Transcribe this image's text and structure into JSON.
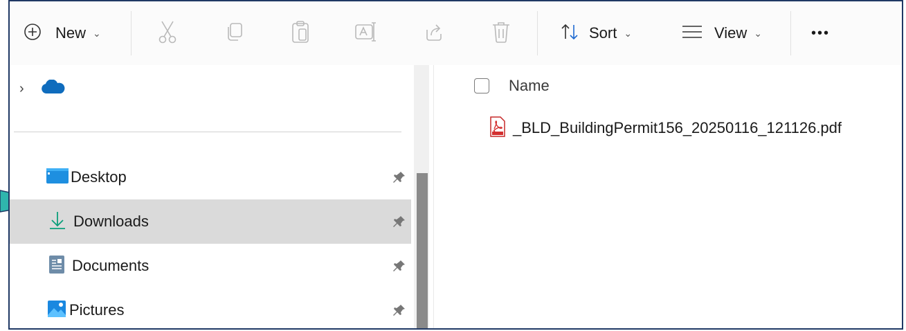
{
  "toolbar": {
    "new_label": "New",
    "sort_label": "Sort",
    "view_label": "View",
    "more_label": "•••",
    "icons": [
      "plus-circle-icon",
      "cut-icon",
      "copy-icon",
      "paste-icon",
      "rename-icon",
      "share-icon",
      "delete-icon",
      "sort-icon",
      "view-lines-icon"
    ]
  },
  "nav": {
    "cloud_icon": "onedrive-cloud-icon",
    "items": [
      {
        "label": "Desktop",
        "icon": "desktop-icon"
      },
      {
        "label": "Downloads",
        "icon": "download-arrow-icon",
        "selected": true
      },
      {
        "label": "Documents",
        "icon": "documents-icon"
      },
      {
        "label": "Pictures",
        "icon": "pictures-icon"
      }
    ]
  },
  "content": {
    "column_name": "Name",
    "files": [
      {
        "name": "_BLD_BuildingPermit156_20250116_121126.pdf",
        "icon": "pdf-icon"
      }
    ]
  },
  "colors": {
    "accent_cloud": "#0f6cbd",
    "download_green": "#0a9e7a",
    "selected_row": "#dadada",
    "callout_teal": "#149b9b",
    "frame_border": "#1f3864"
  }
}
